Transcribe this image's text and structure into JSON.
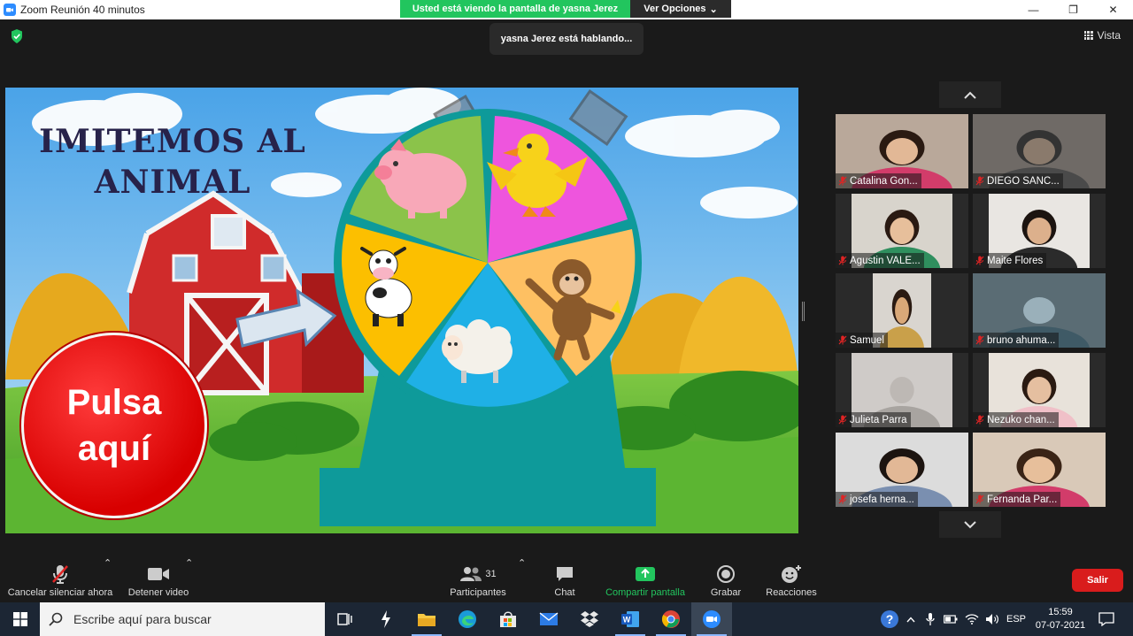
{
  "window": {
    "title": "Zoom Reunión 40 minutos",
    "controls": {
      "minimize": "—",
      "restore": "❐",
      "close": "✕"
    }
  },
  "share_banner": {
    "text": "Usted está viendo la pantalla de yasna Jerez",
    "options_label": "Ver Opciones",
    "options_caret": "⌄"
  },
  "speaking_indicator": "yasna Jerez está hablando...",
  "view_button": "Vista",
  "slide": {
    "title_line1": "IMITEMOS AL",
    "title_line2": "ANIMAL",
    "button_line1": "Pulsa",
    "button_line2": "aquí",
    "wheel_segments": [
      "pig",
      "duck",
      "monkey",
      "sheep",
      "cow"
    ]
  },
  "gallery": {
    "up_arrow": "⌃",
    "down_arrow": "⌄",
    "participants": [
      {
        "name": "Catalina Gon...",
        "muted": true
      },
      {
        "name": "DIEGO SANC...",
        "muted": true
      },
      {
        "name": "Agustin VALE...",
        "muted": true
      },
      {
        "name": "Maite Flores",
        "muted": true
      },
      {
        "name": "Samuel",
        "muted": true
      },
      {
        "name": "bruno ahuma...",
        "muted": true
      },
      {
        "name": "Julieta Parra",
        "muted": true
      },
      {
        "name": "Nezuko chan...",
        "muted": true
      },
      {
        "name": "josefa herna...",
        "muted": true
      },
      {
        "name": "Fernanda Par...",
        "muted": true
      }
    ]
  },
  "toolbar": {
    "unmute_label": "Cancelar silenciar ahora",
    "video_label": "Detener video",
    "participants_label": "Participantes",
    "participants_count": "31",
    "chat_label": "Chat",
    "share_label": "Compartir pantalla",
    "record_label": "Grabar",
    "reactions_label": "Reacciones",
    "leave_label": "Salir",
    "caret": "⌃"
  },
  "taskbar": {
    "search_placeholder": "Escribe aquí para buscar",
    "language": "ESP",
    "time": "15:59",
    "date": "07-07-2021",
    "apps": [
      "task-view",
      "app-a",
      "file-explorer",
      "edge",
      "store",
      "mail",
      "dropbox",
      "word",
      "chrome",
      "zoom"
    ]
  },
  "colors": {
    "share_green": "#22c55e",
    "leave_red": "#d91c1c",
    "zoom_blue": "#2d8cff",
    "taskbar": "#1c2634",
    "slide_title": "#27224a",
    "wheel_teal": "#0e9a9a"
  }
}
